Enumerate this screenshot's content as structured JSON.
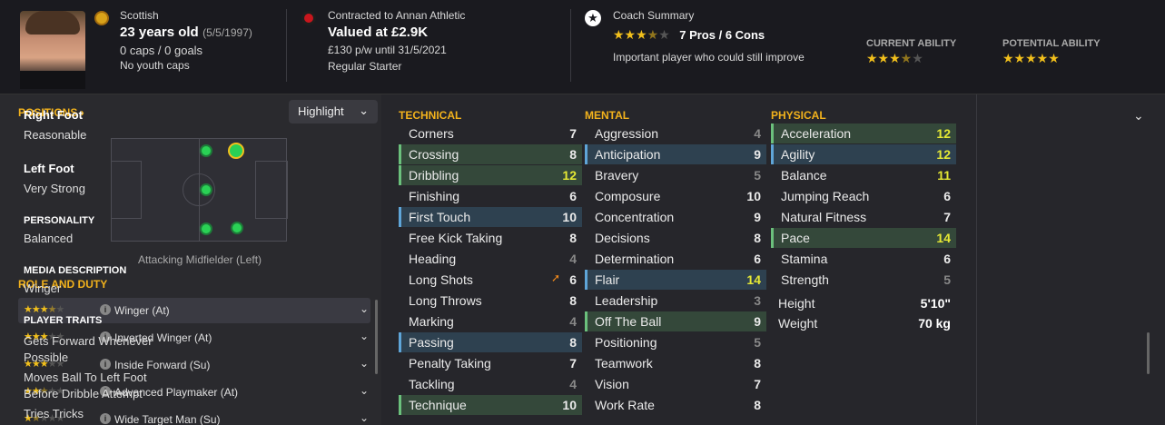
{
  "player": {
    "nationality": "Scottish",
    "age": "23 years old",
    "dob": "(5/5/1997)",
    "caps": "0 caps / 0 goals",
    "youth_caps": "No youth caps"
  },
  "contract": {
    "club": "Contracted to Annan Athletic",
    "value": "Valued at £2.9K",
    "wage": "£130 p/w until 31/5/2021",
    "status": "Regular Starter"
  },
  "coach": {
    "title": "Coach Summary",
    "pros_cons": "7 Pros / 6 Cons",
    "comment": "Important player who could still improve",
    "rating_stars": 3.5,
    "current_label": "CURRENT ABILITY",
    "current_stars": 3.5,
    "potential_label": "POTENTIAL ABILITY",
    "potential_stars": 5
  },
  "positions": {
    "title": "POSITIONS",
    "chevron": "›",
    "highlight_label": "Highlight",
    "current_position": "Attacking Midfielder (Left)"
  },
  "roles": {
    "title": "ROLE AND DUTY",
    "items": [
      {
        "stars": 3.5,
        "label": "Winger (At)",
        "selected": true
      },
      {
        "stars": 3,
        "label": "Inverted Winger (At)"
      },
      {
        "stars": 3,
        "label": "Inside Forward (Su)"
      },
      {
        "stars": 2.5,
        "label": "Advanced Playmaker (At)"
      },
      {
        "stars": 1.5,
        "label": "Wide Target Man (Su)"
      }
    ]
  },
  "technical": {
    "title": "TECHNICAL",
    "rows": [
      {
        "name": "Corners",
        "value": "7",
        "hl": ""
      },
      {
        "name": "Crossing",
        "value": "8",
        "hl": "green"
      },
      {
        "name": "Dribbling",
        "value": "12",
        "hl": "green"
      },
      {
        "name": "Finishing",
        "value": "6",
        "hl": ""
      },
      {
        "name": "First Touch",
        "value": "10",
        "hl": "blue"
      },
      {
        "name": "Free Kick Taking",
        "value": "8",
        "hl": ""
      },
      {
        "name": "Heading",
        "value": "4",
        "hl": ""
      },
      {
        "name": "Long Shots",
        "value": "6",
        "hl": "",
        "trend": "up"
      },
      {
        "name": "Long Throws",
        "value": "8",
        "hl": ""
      },
      {
        "name": "Marking",
        "value": "4",
        "hl": ""
      },
      {
        "name": "Passing",
        "value": "8",
        "hl": "blue"
      },
      {
        "name": "Penalty Taking",
        "value": "7",
        "hl": ""
      },
      {
        "name": "Tackling",
        "value": "4",
        "hl": ""
      },
      {
        "name": "Technique",
        "value": "10",
        "hl": "green"
      }
    ]
  },
  "mental": {
    "title": "MENTAL",
    "rows": [
      {
        "name": "Aggression",
        "value": "4",
        "hl": ""
      },
      {
        "name": "Anticipation",
        "value": "9",
        "hl": "blue"
      },
      {
        "name": "Bravery",
        "value": "5",
        "hl": ""
      },
      {
        "name": "Composure",
        "value": "10",
        "hl": ""
      },
      {
        "name": "Concentration",
        "value": "9",
        "hl": ""
      },
      {
        "name": "Decisions",
        "value": "8",
        "hl": ""
      },
      {
        "name": "Determination",
        "value": "6",
        "hl": ""
      },
      {
        "name": "Flair",
        "value": "14",
        "hl": "blue"
      },
      {
        "name": "Leadership",
        "value": "3",
        "hl": ""
      },
      {
        "name": "Off The Ball",
        "value": "9",
        "hl": "green"
      },
      {
        "name": "Positioning",
        "value": "5",
        "hl": ""
      },
      {
        "name": "Teamwork",
        "value": "8",
        "hl": ""
      },
      {
        "name": "Vision",
        "value": "7",
        "hl": ""
      },
      {
        "name": "Work Rate",
        "value": "8",
        "hl": ""
      }
    ]
  },
  "physical": {
    "title": "PHYSICAL",
    "rows": [
      {
        "name": "Acceleration",
        "value": "12",
        "hl": "green"
      },
      {
        "name": "Agility",
        "value": "12",
        "hl": "blue"
      },
      {
        "name": "Balance",
        "value": "11",
        "hl": ""
      },
      {
        "name": "Jumping Reach",
        "value": "6",
        "hl": ""
      },
      {
        "name": "Natural Fitness",
        "value": "7",
        "hl": ""
      },
      {
        "name": "Pace",
        "value": "14",
        "hl": "green"
      },
      {
        "name": "Stamina",
        "value": "6",
        "hl": ""
      },
      {
        "name": "Strength",
        "value": "5",
        "hl": ""
      }
    ],
    "height_label": "Height",
    "height": "5'10\"",
    "weight_label": "Weight",
    "weight": "70 kg"
  },
  "info": {
    "right_foot_label": "Right Foot",
    "right_foot": "Reasonable",
    "left_foot_label": "Left Foot",
    "left_foot": "Very Strong",
    "personality_label": "PERSONALITY",
    "personality": "Balanced",
    "media_label": "MEDIA DESCRIPTION",
    "media": "Winger",
    "traits_label": "PLAYER TRAITS",
    "traits": [
      "Gets Forward Whenever Possible",
      "Moves Ball To Left Foot Before Dribble Attempt",
      "Tries Tricks"
    ]
  },
  "colors": {
    "accent": "#f2b21c",
    "high": "#e5e834",
    "blue_hl": "#2e4150",
    "green_hl": "#34483a"
  }
}
